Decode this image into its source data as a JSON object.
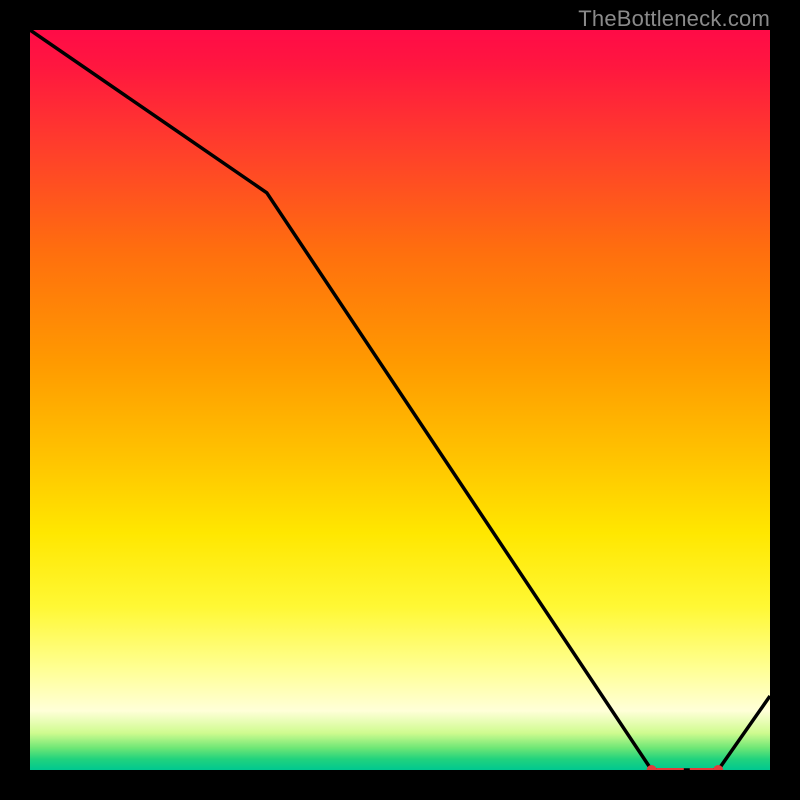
{
  "attribution": "TheBottleneck.com",
  "colors": {
    "bg": "#000000",
    "curve": "#000000",
    "marker": "#e43b3b",
    "attribution": "#8a8a8a"
  },
  "chart_data": {
    "type": "line",
    "title": "",
    "xlabel": "",
    "ylabel": "",
    "xlim": [
      0,
      100
    ],
    "ylim": [
      0,
      100
    ],
    "x": [
      0,
      32,
      84,
      93,
      100
    ],
    "values": [
      100,
      78,
      0,
      0,
      10
    ],
    "highlight": {
      "start": 84,
      "end": 93,
      "style": "dashed"
    }
  }
}
